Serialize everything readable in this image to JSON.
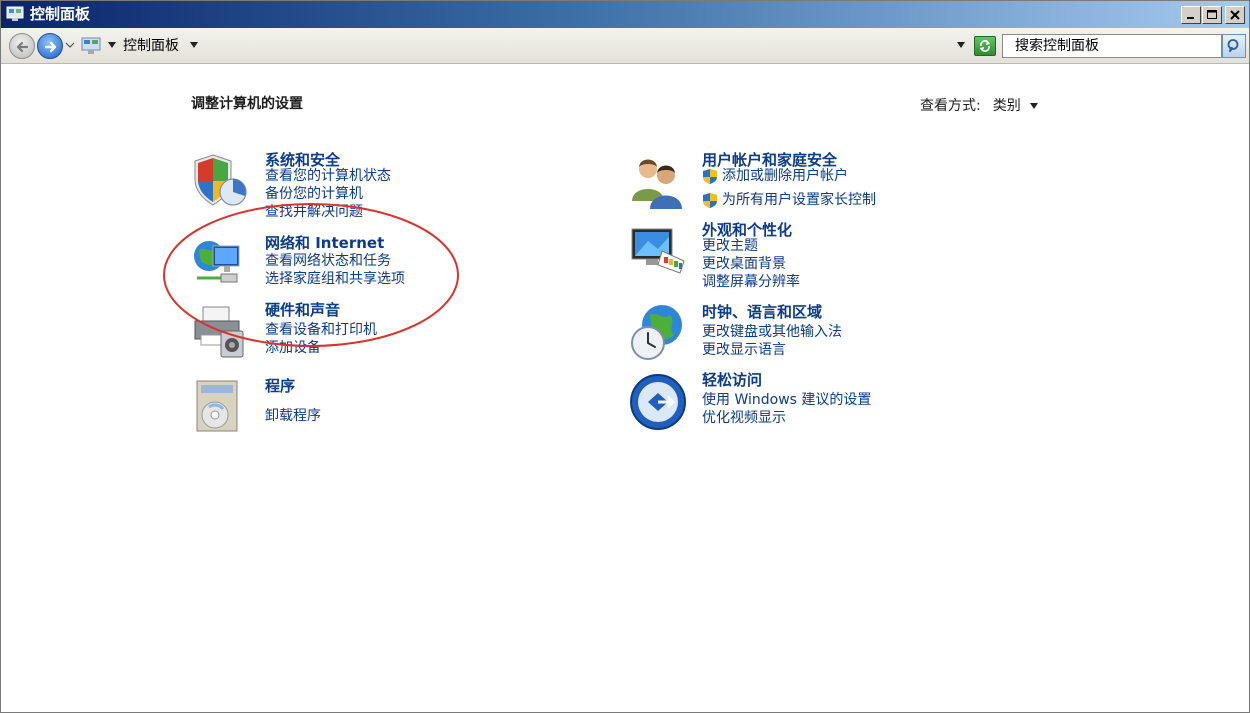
{
  "window": {
    "title": "控制面板",
    "controls": [
      "minimize",
      "maximize",
      "close"
    ]
  },
  "address_bar": {
    "path": "控制面板",
    "search_placeholder": "搜索控制面板"
  },
  "header": {
    "heading": "调整计算机的设置",
    "view_by_label": "查看方式:",
    "view_by_value": "类别"
  },
  "categories": [
    {
      "id": "system-security",
      "icon": "shield-chart-icon",
      "title": "系统和安全",
      "links": [
        "查看您的计算机状态",
        "备份您的计算机",
        "查找并解决问题"
      ]
    },
    {
      "id": "network-internet",
      "icon": "globe-network-icon",
      "title": "网络和 Internet",
      "links": [
        "查看网络状态和任务",
        "选择家庭组和共享选项"
      ]
    },
    {
      "id": "hardware-sound",
      "icon": "printer-speaker-icon",
      "title": "硬件和声音",
      "links": [
        "查看设备和打印机",
        "添加设备"
      ]
    },
    {
      "id": "programs",
      "icon": "programs-disc-icon",
      "title": "程序",
      "links": [
        "卸载程序"
      ]
    },
    {
      "id": "user-accounts",
      "icon": "users-icon",
      "title": "用户帐户和家庭安全",
      "links": [
        "添加或删除用户帐户",
        "为所有用户设置家长控制"
      ]
    },
    {
      "id": "appearance",
      "icon": "monitor-palette-icon",
      "title": "外观和个性化",
      "links": [
        "更改主题",
        "更改桌面背景",
        "调整屏幕分辨率"
      ]
    },
    {
      "id": "clock-language",
      "icon": "globe-clock-icon",
      "title": "时钟、语言和区域",
      "links": [
        "更改键盘或其他输入法",
        "更改显示语言"
      ]
    },
    {
      "id": "ease-of-access",
      "icon": "ease-of-access-icon",
      "title": "轻松访问",
      "links": [
        "使用 Windows 建议的设置",
        "优化视频显示"
      ]
    }
  ],
  "colors": {
    "link": "#0b3b8c",
    "annotation": "#d9342b",
    "title_bar_start": "#0a246a",
    "title_bar_end": "#a6caf0"
  }
}
